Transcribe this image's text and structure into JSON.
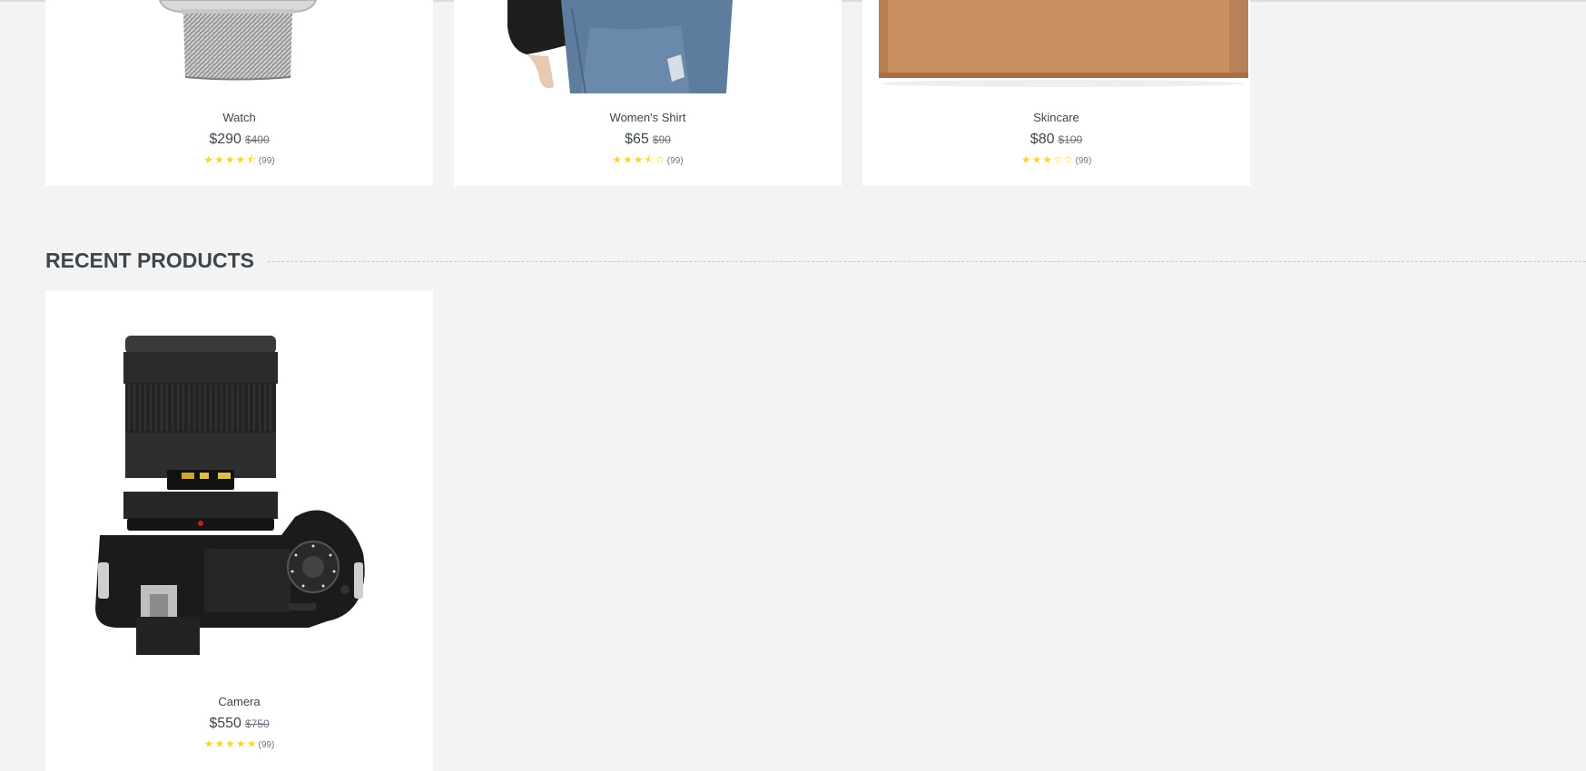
{
  "featured_products": [
    {
      "name": "Watch",
      "price": "$290",
      "old_price": "$400",
      "rating": 4.5,
      "stars": "★★★★⯪",
      "reviews": "(99)"
    },
    {
      "name": "Women's Shirt",
      "price": "$65",
      "old_price": "$90",
      "rating": 3.5,
      "stars": "★★★⯪☆",
      "reviews": "(99)"
    },
    {
      "name": "Skincare",
      "price": "$80",
      "old_price": "$100",
      "rating": 3,
      "stars": "★★★☆☆",
      "reviews": "(99)"
    }
  ],
  "recent_section": {
    "title": "RECENT PRODUCTS",
    "products": [
      {
        "name": "Camera",
        "price": "$550",
        "old_price": "$750",
        "rating": 5,
        "stars": "★★★★★",
        "reviews": "(99)"
      }
    ]
  },
  "colors": {
    "background": "#f3f3f3",
    "card": "#ffffff",
    "star": "#ffd333",
    "text": "#3d464d"
  }
}
